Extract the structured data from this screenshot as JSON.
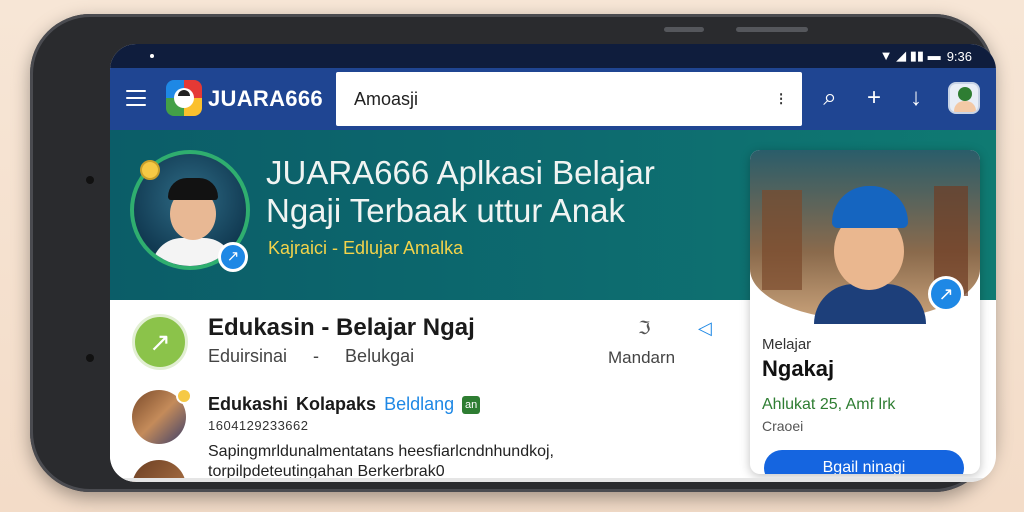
{
  "status": {
    "time": "9:36",
    "icons": "▼ ◢ ▮▮ ▬"
  },
  "appbar": {
    "brand": "JUARA666",
    "search_value": "Amoasji",
    "mic_glyph": "⁝",
    "search_glyph": "⌕",
    "add_glyph": "+",
    "download_glyph": "↓"
  },
  "hero": {
    "title": "JUARA666 Aplkasi Belajar Ngaji Terbaak uttur Anak",
    "subtitle": "Kajraici - Edlujar Amalka",
    "badge_glyph": "↗"
  },
  "row1": {
    "title": "Edukasin - Belajar Ngaj",
    "sub_left": "Eduirsinai",
    "sub_sep": "-",
    "sub_mid": "Belukgai",
    "right_text": "Mandarn",
    "icon_a": "ℑ",
    "icon_b": "◁",
    "icon_glyph": "↗"
  },
  "row2": {
    "title": "Edukashi",
    "title_mid": "Kolapaks",
    "title_blue": "Beldlang",
    "chip": "an",
    "number": "1604129233662",
    "text": "Sapingmrldunalmentatans heesfiarlcndnhundkoj, torpilpdeteutingahan Berkerbrak0"
  },
  "card": {
    "label_small": "Melajar",
    "title": "Ngakaj",
    "green_text": "Ahlukat 25, Amf lrk",
    "gray_text": "Craoei",
    "button": "Bgail ninagi",
    "badge_glyph": "↗"
  },
  "colors": {
    "appbar": "#1f4592",
    "hero": "#0d6b6f",
    "accent": "#1565e0",
    "subtitle": "#f3d34a"
  }
}
